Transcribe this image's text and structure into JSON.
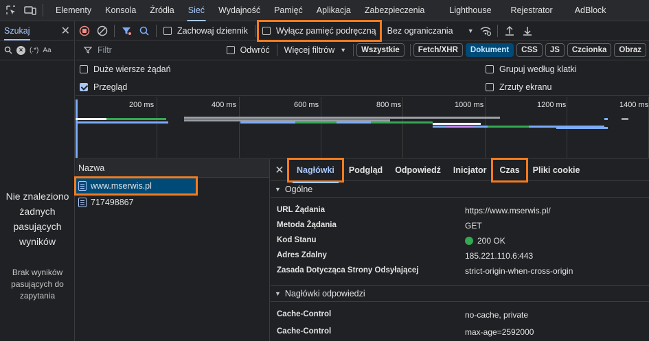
{
  "devtools_tabs": [
    "Elementy",
    "Konsola",
    "Źródła",
    "Sieć",
    "Wydajność",
    "Pamięć",
    "Aplikacja",
    "Zabezpieczenia",
    "Lighthouse",
    "Rejestrator",
    "AdBlock"
  ],
  "active_tab": "Sieć",
  "search_panel": {
    "title": "Szukaj",
    "regex_label": "(.*)",
    "case_label": "Aa",
    "no_results_title": "Nie znaleziono żadnych pasujących wyników",
    "no_results_sub": "Brak wyników pasujących do zapytania"
  },
  "toolbar": {
    "preserve_log": "Zachowaj dziennik",
    "disable_cache": "Wyłącz pamięć podręczną",
    "throttling": "Bez ograniczania"
  },
  "filter": {
    "placeholder": "Filtr",
    "invert": "Odwróć",
    "more_filters": "Więcej filtrów",
    "chips": [
      "Wszystkie",
      "Fetch/XHR",
      "Dokument",
      "CSS",
      "JS",
      "Czcionka",
      "Obraz"
    ],
    "active_chip": "Dokument"
  },
  "options": {
    "large_rows": "Duże wiersze żądań",
    "overview": "Przegląd",
    "group_by_frame": "Grupuj według klatki",
    "screenshots": "Zrzuty ekranu"
  },
  "overview_ticks": [
    "200 ms",
    "400 ms",
    "600 ms",
    "800 ms",
    "1000 ms",
    "1200 ms",
    "1400 ms"
  ],
  "requests": {
    "header": "Nazwa",
    "rows": [
      "www.mserwis.pl",
      "717498867"
    ]
  },
  "details": {
    "tabs": [
      "Nagłówki",
      "Podgląd",
      "Odpowiedź",
      "Inicjator",
      "Czas",
      "Pliki cookie"
    ],
    "active_tab": "Nagłówki",
    "general_title": "Ogólne",
    "general": [
      {
        "key": "URL Żądania",
        "value": "https://www.mserwis.pl/"
      },
      {
        "key": "Metoda Żądania",
        "value": "GET"
      },
      {
        "key": "Kod Stanu",
        "value": "200 OK"
      },
      {
        "key": "Adres Zdalny",
        "value": "185.221.110.6:443"
      },
      {
        "key": "Zasada Dotycząca Strony Odsyłającej",
        "value": "strict-origin-when-cross-origin"
      }
    ],
    "response_headers_title": "Nagłówki odpowiedzi",
    "response_headers": [
      {
        "key": "Cache-Control",
        "value": "no-cache, private"
      },
      {
        "key": "Cache-Control",
        "value": "max-age=2592000"
      }
    ]
  },
  "colors": {
    "highlight": "#f47b20",
    "accent": "#a8c7fa",
    "status_ok": "#34a853"
  }
}
